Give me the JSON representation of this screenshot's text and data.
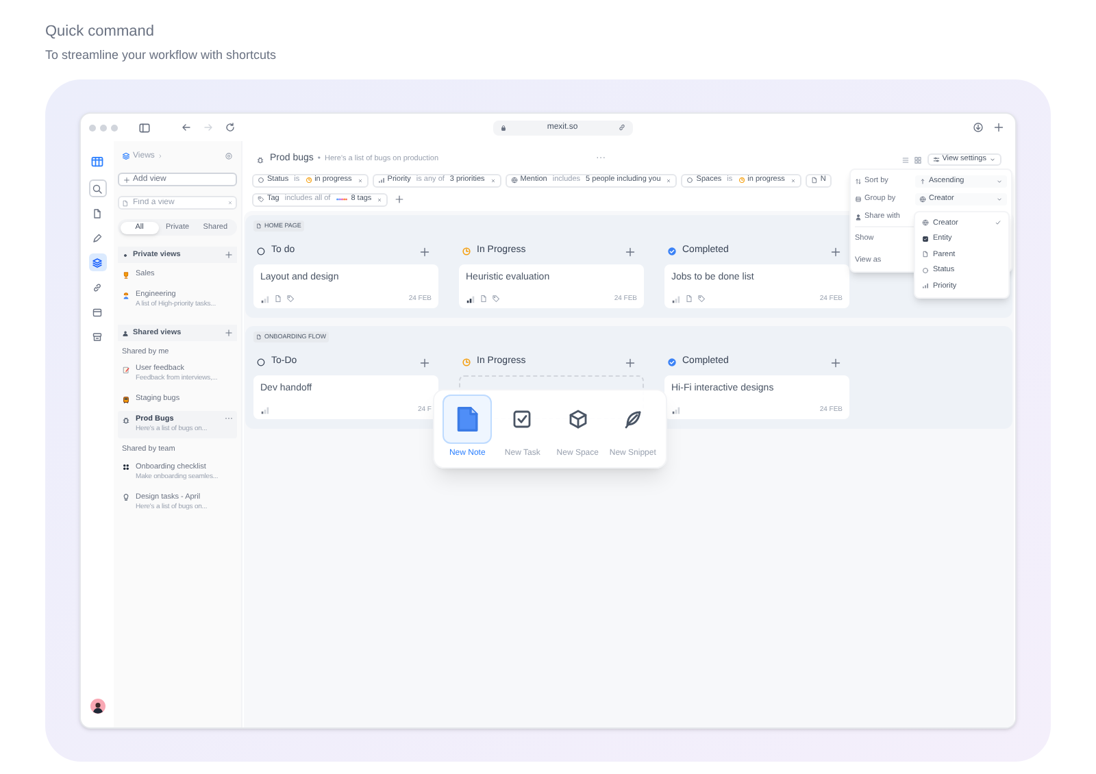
{
  "header": {
    "title": "Quick command",
    "subtitle": "To streamline your workflow with shortcuts"
  },
  "browser": {
    "url": "mexit.so"
  },
  "rail": [
    {
      "kind": "search",
      "selected": false
    },
    {
      "kind": "doc",
      "selected": false
    },
    {
      "kind": "pen",
      "selected": false
    },
    {
      "kind": "stack",
      "selected": true
    },
    {
      "kind": "link",
      "selected": false
    },
    {
      "kind": "calendar",
      "selected": false
    },
    {
      "kind": "archive",
      "selected": false
    }
  ],
  "sidebar": {
    "title": "Views",
    "add_button": "Add view",
    "search": {
      "placeholder": "Find a view"
    },
    "filters": [
      {
        "label": "All",
        "selected": true
      },
      {
        "label": "Private",
        "selected": false
      },
      {
        "label": "Shared",
        "selected": false
      }
    ],
    "sections": [
      {
        "kind": "private",
        "title": "Private views",
        "groups": [
          {
            "items": [
              {
                "kind": "trophy",
                "title": "Sales",
                "selected": false
              },
              {
                "kind": "worker",
                "title": "Engineering",
                "description": "A list of High-priority tasks...",
                "selected": false
              }
            ]
          }
        ]
      },
      {
        "kind": "shared",
        "title": "Shared views",
        "groups": [
          {
            "title": "Shared by me",
            "items": [
              {
                "kind": "memo",
                "title": "User feedback",
                "description": "Feedback from interviews,...",
                "selected": false
              },
              {
                "kind": "bus",
                "title": "Staging bugs",
                "selected": false
              },
              {
                "kind": "bug",
                "title": "Prod Bugs",
                "description": "Here's a list of bugs on...",
                "selected": true,
                "more": "···"
              }
            ]
          },
          {
            "title": "Shared by team",
            "items": [
              {
                "kind": "team",
                "title": "Onboarding checklist",
                "description": "Make onboarding seamles...",
                "selected": false
              },
              {
                "kind": "bulb",
                "title": "Design tasks - April",
                "description": "Here's a list of bugs on...",
                "selected": false
              }
            ]
          }
        ]
      }
    ]
  },
  "main": {
    "title": "Prod bugs",
    "separator": "•",
    "description": "Here's a list of bugs on production",
    "more": "···",
    "view_settings": "View settings",
    "filter_rows": [
      [
        {
          "kind": "status",
          "field": "Status",
          "operator": "is",
          "value": "in progress"
        },
        {
          "kind": "priority",
          "field": "Priority",
          "operator": "is any of",
          "value": "3 priorities"
        },
        {
          "kind": "mention",
          "field": "Mention",
          "operator": "includes",
          "value": "5 people including you"
        },
        {
          "kind": "status",
          "field": "Spaces",
          "operator": "is",
          "value": "in progress"
        },
        {
          "kind": "page",
          "field": "N"
        }
      ],
      [
        {
          "kind": "tag",
          "field": "Tag",
          "operator": "includes all of",
          "value": "8 tags"
        }
      ]
    ],
    "groups": [
      {
        "title": "HOME PAGE",
        "columns": [
          {
            "kind": "todo",
            "title": "To do",
            "cards": [
              {
                "kind": "detailed",
                "title": "Layout and design",
                "date": "24 FEB"
              }
            ]
          },
          {
            "kind": "progress",
            "title": "In Progress",
            "cards": [
              {
                "kind": "detailed",
                "title": "Heuristic evaluation",
                "date": "24 FEB"
              }
            ]
          },
          {
            "kind": "done",
            "title": "Completed",
            "cards": [
              {
                "kind": "detailed",
                "title": "Jobs to be done list",
                "date": "24 FEB"
              }
            ]
          }
        ]
      },
      {
        "title": "ONBOARDING FLOW",
        "columns": [
          {
            "kind": "todo",
            "title": "To-Do",
            "cards": [
              {
                "kind": "simple",
                "title": "Dev handoff",
                "date": "24 F"
              }
            ]
          },
          {
            "kind": "progress",
            "title": "In Progress",
            "cards": [
              {
                "kind": "placeholder"
              }
            ]
          },
          {
            "kind": "done",
            "title": "Completed",
            "cards": [
              {
                "kind": "simple",
                "title": "Hi-Fi interactive designs",
                "date": "24 FEB"
              }
            ]
          }
        ]
      }
    ],
    "settings_menu": {
      "rows": [
        {
          "kind": "sort",
          "label": "Sort by",
          "control": "Ascending"
        },
        {
          "kind": "group",
          "label": "Group by",
          "control": "Creator"
        },
        {
          "kind": "share",
          "label": "Share with"
        },
        {
          "kind": "plain",
          "label": "Show"
        },
        {
          "kind": "plain",
          "label": "View as"
        }
      ],
      "options": [
        {
          "kind": "creator",
          "label": "Creator",
          "selected": true
        },
        {
          "kind": "entity",
          "label": "Entity",
          "selected": false
        },
        {
          "kind": "parent",
          "label": "Parent",
          "selected": false
        },
        {
          "kind": "status",
          "label": "Status",
          "selected": false
        },
        {
          "kind": "priority",
          "label": "Priority",
          "selected": false
        }
      ]
    },
    "quick_command": {
      "items": [
        {
          "kind": "note",
          "label": "New Note",
          "selected": true
        },
        {
          "kind": "task",
          "label": "New Task",
          "selected": false
        },
        {
          "kind": "space",
          "label": "New Space",
          "selected": false
        },
        {
          "kind": "snippet",
          "label": "New Snippet",
          "selected": false
        }
      ]
    }
  }
}
